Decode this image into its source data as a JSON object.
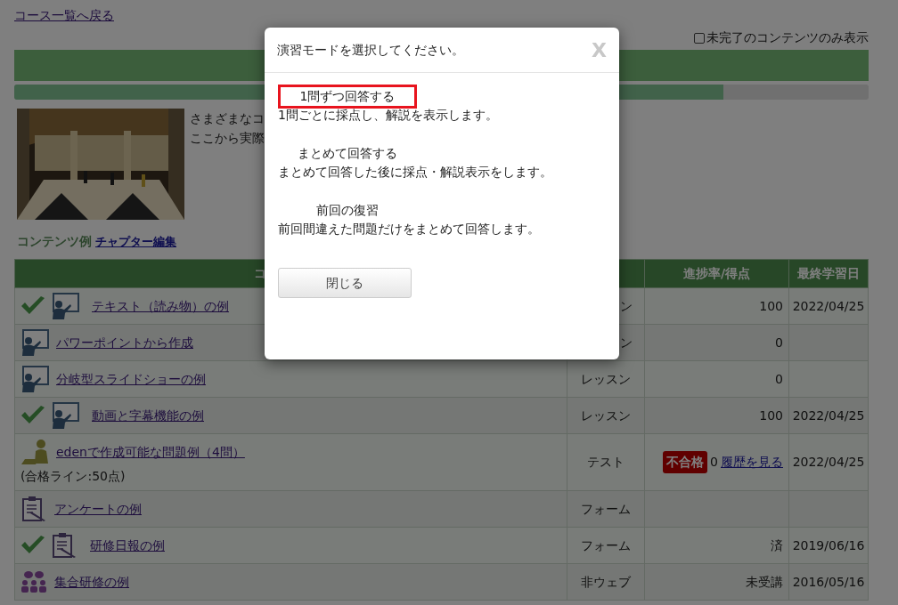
{
  "back_link": "コース一覧へ戻る",
  "filter": {
    "label": "未完了のコンテンツのみ表示",
    "checked": false
  },
  "progress": {
    "level": 0.83
  },
  "intro": {
    "kind": "picture",
    "lines": [
      "さまざまなコ",
      "ここから実際"
    ]
  },
  "section": {
    "title": "コンテンツ例",
    "edit_link": "チャプター編集"
  },
  "table": {
    "columns": [
      "コ",
      "",
      "進捗率/得点",
      "最終学習日"
    ],
    "rows": [
      {
        "done": true,
        "kind": "lesson",
        "title": "テキスト（読み物）の例",
        "type": "ン",
        "progress": "100",
        "date": "2022/04/25"
      },
      {
        "done": false,
        "kind": "lesson",
        "title": "パワーポイントから作成",
        "type": "ン",
        "progress": "0"
      },
      {
        "done": false,
        "kind": "lesson",
        "title": "分岐型スライドショーの例",
        "type": "レッスン",
        "progress": "0"
      },
      {
        "done": true,
        "kind": "lesson",
        "title": "動画と字幕機能の例",
        "type": "レッスン",
        "progress": "100",
        "date": "2022/04/25"
      },
      {
        "done": false,
        "kind": "test",
        "title": "edenで作成可能な問題例（4問）",
        "note": "(合格ライン:50点)",
        "type": "テスト",
        "badge": "不合格",
        "progress": "0",
        "history_link": "履歴を見る",
        "date": "2022/04/25"
      },
      {
        "done": false,
        "kind": "form",
        "title": "アンケートの例",
        "type": "フォーム"
      },
      {
        "done": true,
        "kind": "form",
        "title": "研修日報の例",
        "type": "フォーム",
        "progress": "済",
        "date": "2019/06/16"
      },
      {
        "done": false,
        "kind": "group",
        "title": "集合研修の例",
        "type": "非ウェブ",
        "progress": "未受講",
        "date": "2016/05/16"
      }
    ]
  },
  "dialog": {
    "title": "演習モードを選択してください。",
    "close_x": "X",
    "modes": [
      {
        "label": "1問ずつ回答する",
        "description": "1問ごとに採点し、解説を表示します。",
        "selected": true
      },
      {
        "label": "まとめて回答する",
        "description": "まとめて回答した後に採点・解説表示をします。",
        "selected": false
      },
      {
        "label": "前回の復習",
        "description": "前回間違えた問題だけをまとめて回答します。",
        "selected": false
      }
    ],
    "close_button": "閉じる"
  }
}
